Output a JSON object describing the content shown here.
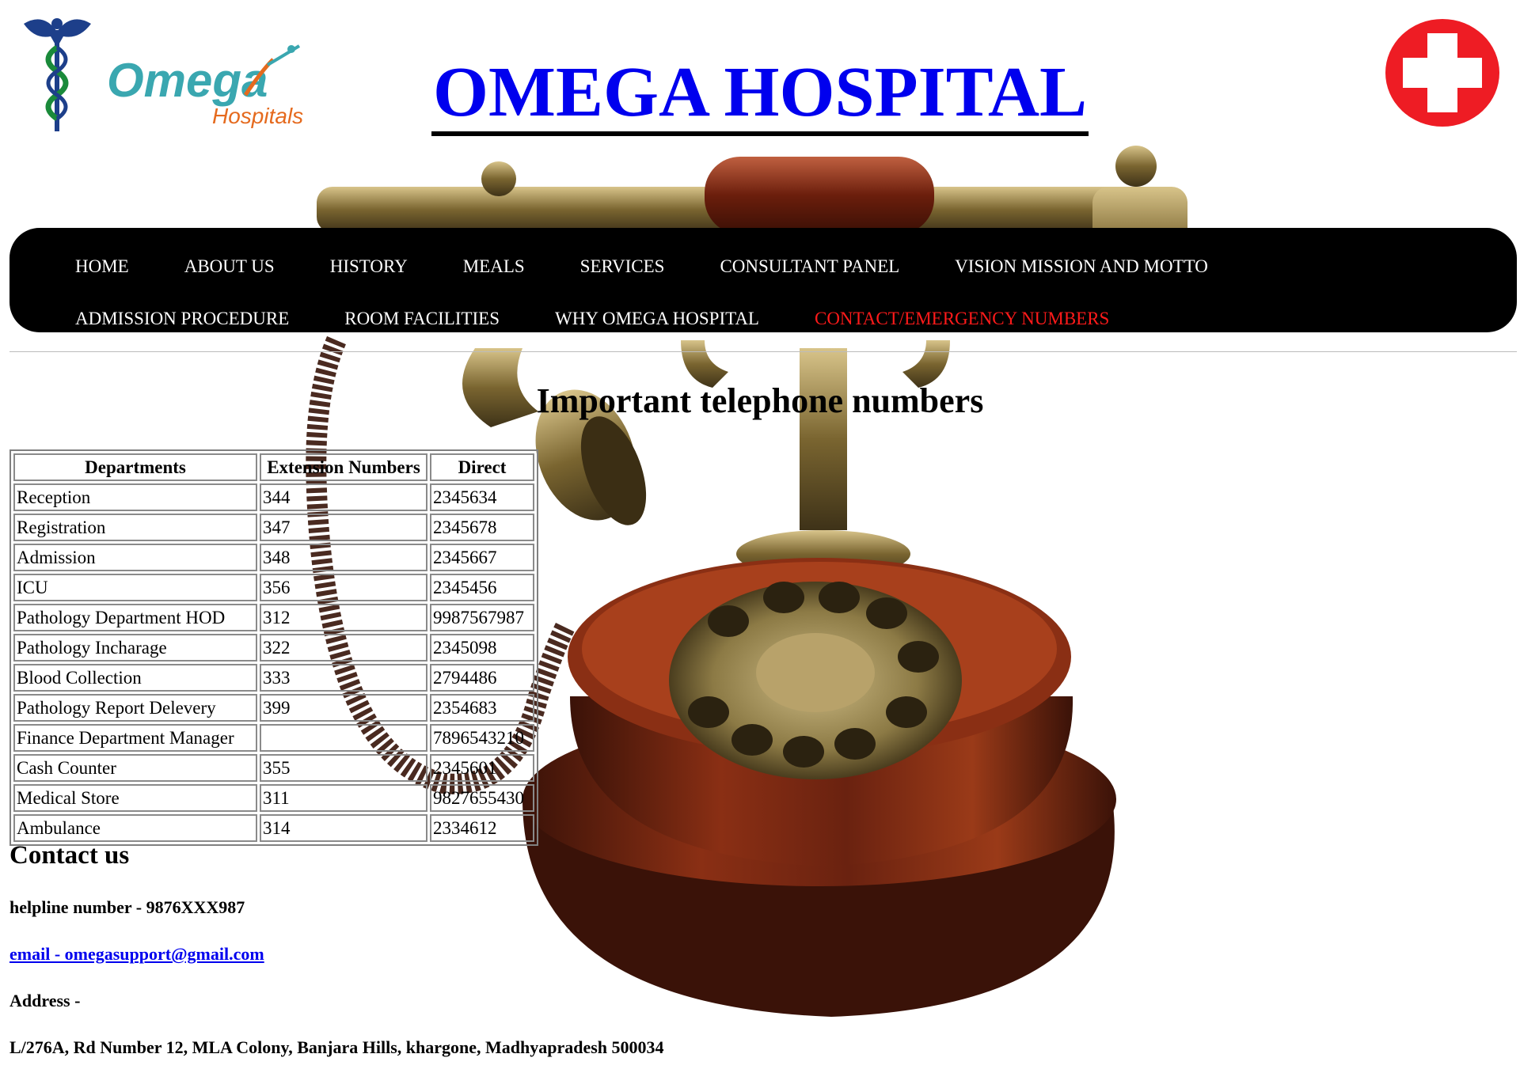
{
  "header": {
    "logo_text": "Omega",
    "logo_subtext": "Hospitals",
    "title": "OMEGA HOSPITAL"
  },
  "nav": {
    "row1": [
      "HOME",
      "ABOUT US",
      "HISTORY",
      "MEALS",
      "SERVICES",
      "CONSULTANT PANEL",
      "VISION MISSION AND MOTTO"
    ],
    "row2": [
      "ADMISSION PROCEDURE",
      "ROOM FACILITIES",
      "WHY OMEGA HOSPITAL",
      "CONTACT/EMERGENCY NUMBERS"
    ],
    "active": "CONTACT/EMERGENCY NUMBERS",
    "active_color": "#ff1a1a"
  },
  "phones": {
    "heading": "Important telephone numbers",
    "columns": [
      "Departments",
      "Extension Numbers",
      "Direct"
    ],
    "rows": [
      [
        "Reception",
        "344",
        "2345634"
      ],
      [
        "Registration",
        "347",
        "2345678"
      ],
      [
        "Admission",
        "348",
        "2345667"
      ],
      [
        "ICU",
        "356",
        "2345456"
      ],
      [
        "Pathology Department HOD",
        "312",
        "9987567987"
      ],
      [
        "Pathology Incharage",
        "322",
        "2345098"
      ],
      [
        "Blood Collection",
        "333",
        "2794486"
      ],
      [
        "Pathology Report Delevery",
        "399",
        "2354683"
      ],
      [
        "Finance Department Manager",
        "",
        "7896543210"
      ],
      [
        "Cash Counter",
        "355",
        "2345601"
      ],
      [
        "Medical Store",
        "311",
        "9827655430"
      ],
      [
        "Ambulance",
        "314",
        "2334612"
      ]
    ]
  },
  "contact": {
    "heading": "Contact us",
    "helpline": "helpline number - 9876XXX987",
    "email": "email - omegasupport@gmail.com",
    "address_label": "Address -",
    "address": "L/276A, Rd Number 12, MLA Colony, Banjara Hills, khargone, Madhyapradesh 500034"
  },
  "colors": {
    "link": "#0000ee",
    "nav_bg": "#000000",
    "cross": "#ee1c24"
  }
}
